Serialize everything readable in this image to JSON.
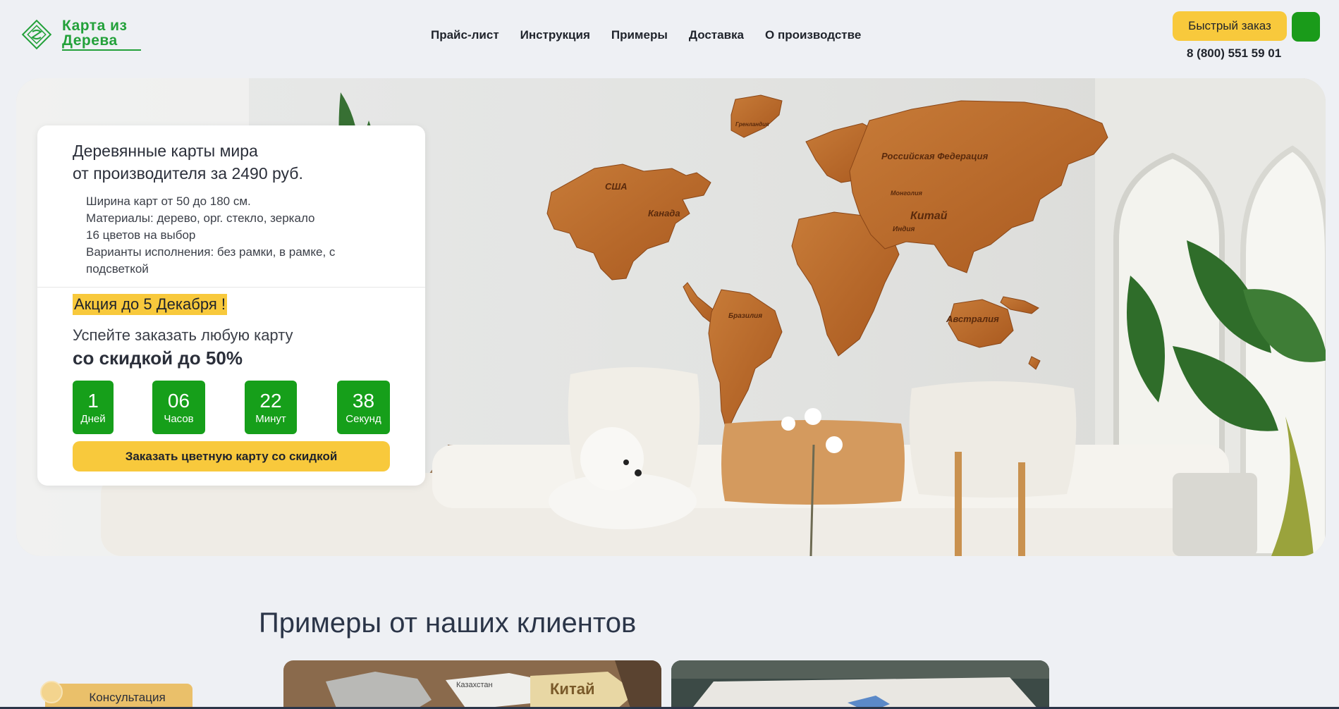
{
  "logo": {
    "line1": "Карта из",
    "line2": "Дерева"
  },
  "nav": [
    "Прайс-лист",
    "Инструкция",
    "Примеры",
    "Доставка",
    "О производстве"
  ],
  "header": {
    "quick_order": "Быстрый заказ",
    "phone": "8 (800) 551 59 01"
  },
  "promo": {
    "title_line1": "Деревянные карты мира",
    "title_line2": "от производителя за 2490 руб.",
    "features": [
      "Ширина карт от 50 до 180 см.",
      "Материалы: дерево, орг. стекло, зеркало",
      "16 цветов на выбор",
      "Варианты исполнения: без рамки, в рамке, с подсветкой"
    ],
    "sale": "Акция до 5 Декабря !",
    "hurry": "Успейте заказать любую карту",
    "discount": "со скидкой до 50%",
    "timer": [
      {
        "value": "1",
        "unit": "Дней"
      },
      {
        "value": "06",
        "unit": "Часов"
      },
      {
        "value": "22",
        "unit": "Минут"
      },
      {
        "value": "38",
        "unit": "Секунд"
      }
    ],
    "cta": "Заказать цветную карту со скидкой"
  },
  "map_labels": {
    "usa": "США",
    "canada": "Канада",
    "russia": "Российская Федерация",
    "china": "Китай",
    "brazil": "Бразилия",
    "australia": "Австралия",
    "india": "Индия",
    "mongolia": "Монголия",
    "greenland": "Гренландия",
    "kazakhstan": "Казахстан"
  },
  "examples": {
    "title": "Примеры от наших клиентов",
    "thumb1_labels": [
      "Казахстан",
      "Китай"
    ]
  },
  "consult": "Консультация",
  "colors": {
    "brand_green": "#23a13a",
    "timer_green": "#169f1a",
    "accent_yellow": "#f8c93c",
    "wood": "#b8692d"
  }
}
